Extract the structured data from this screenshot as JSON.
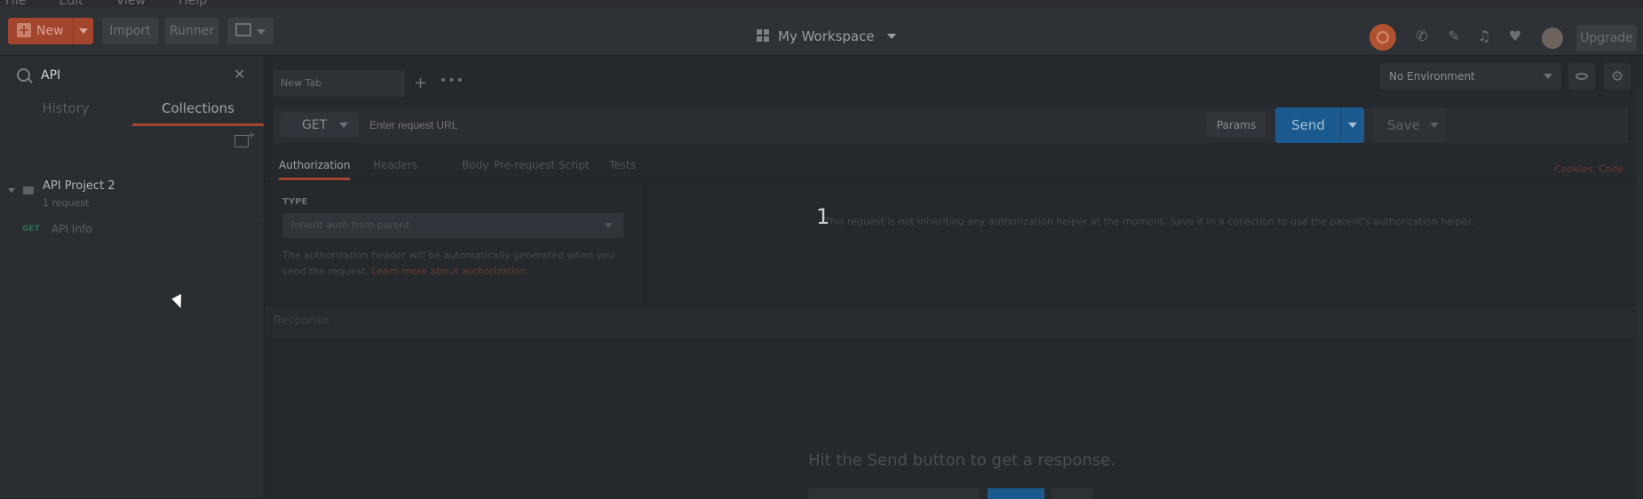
{
  "menu": {
    "items": [
      "File",
      "Edit",
      "View",
      "Help"
    ]
  },
  "header": {
    "new_label": "New",
    "import_label": "Import",
    "runner_label": "Runner",
    "workspace_label": "My Workspace",
    "upgrade_label": "Upgrade"
  },
  "sidebar": {
    "search_value": "API",
    "tabs": [
      "History",
      "Collections"
    ],
    "collection": {
      "name": "API Project 2",
      "count": "1 request"
    },
    "request": {
      "method": "GET",
      "name": "API Info"
    }
  },
  "main": {
    "tab_title": "New Tab",
    "environment": "No Environment",
    "method": "GET",
    "url_placeholder": "Enter request URL",
    "params_label": "Params",
    "send_label": "Send",
    "save_label": "Save",
    "subtabs": [
      "Authorization",
      "Headers",
      "Body",
      "Pre-request Script",
      "Tests"
    ],
    "cookies_label": "Cookies",
    "code_label": "Code",
    "auth_type_label": "TYPE",
    "auth_type_value": "Inherit auth from parent",
    "auth_desc": "The authorization header will be automatically generated when you send the request. ",
    "auth_link": "Learn more about authorization",
    "auth_message": "This request is not inheriting any authorization helper at the moment. Save it in a collection to use the parent's authorization helper.",
    "overlay_number": "1",
    "response_label": "Response",
    "hit_send": "Hit the Send button to get a response."
  },
  "colors": {
    "accent": "#a4452d",
    "send": "#1b5a8e",
    "background": "#24272b"
  }
}
